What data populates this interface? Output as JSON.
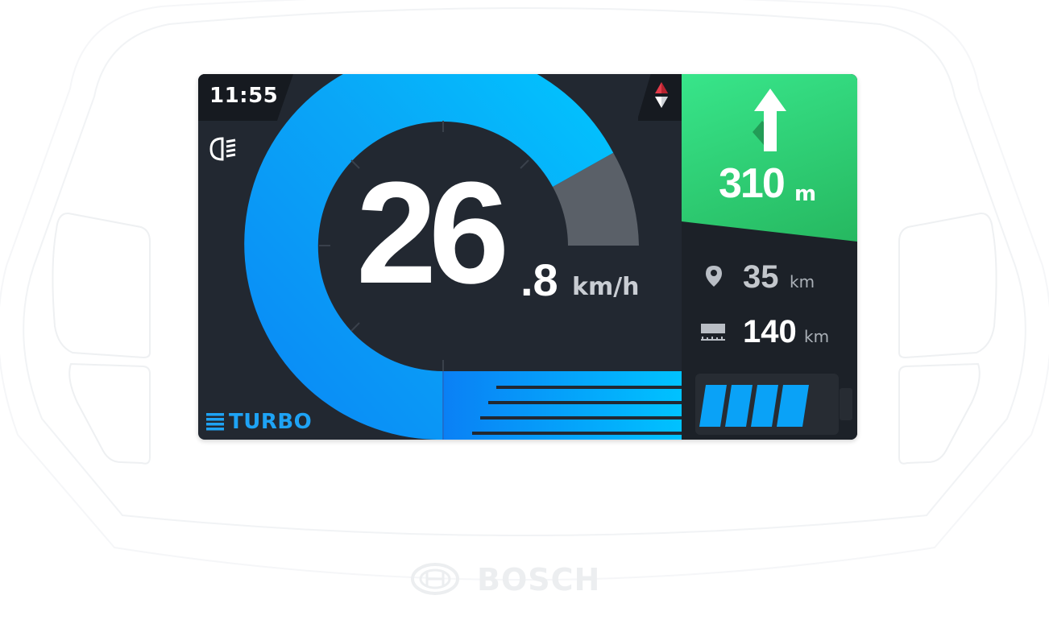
{
  "device": {
    "brand": "BOSCH",
    "clock": "11:55",
    "headlight_icon": "headlight-icon",
    "compass_icon": "compass-icon"
  },
  "speedometer": {
    "speed_integer": "26",
    "speed_decimal": ".8",
    "unit": "km/h",
    "colors": {
      "arc": "#0aa2f7",
      "arc_end": "#00c6ff",
      "remaining": "#5a6068"
    }
  },
  "assist_mode": {
    "label": "TURBO",
    "icon": "assist-level-icon",
    "color": "#1ea3f5"
  },
  "navigation": {
    "distance": "310",
    "unit": "m",
    "direction_icon": "arrow-up-icon",
    "color": "#2fd074"
  },
  "trip_stats": [
    {
      "icon": "location-pin-icon",
      "value": "35",
      "unit": "km"
    },
    {
      "icon": "range-icon",
      "value": "140",
      "unit": "km"
    }
  ],
  "battery": {
    "icon": "battery-icon",
    "level": 1.0,
    "segments_lit": 4,
    "segments_total": 4,
    "color": "#0aa2f7"
  }
}
